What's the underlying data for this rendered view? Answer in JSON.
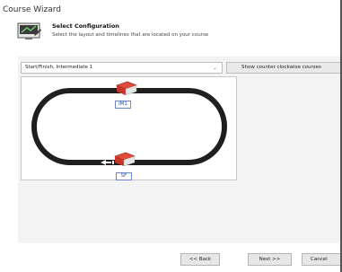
{
  "window": {
    "title": "Course Wizard"
  },
  "header": {
    "title": "Select Configuration",
    "subtitle": "Select the layout and timelines that are located on your course"
  },
  "config": {
    "selected_option": "Start/Finish, Intermediate 1",
    "ccw_button": "Show counter clockwise courses"
  },
  "track": {
    "timeline_top_label": "IM1",
    "timeline_bottom_label": "SF"
  },
  "footer": {
    "back_label": "<< Back",
    "next_label": "Next >>",
    "cancel_label": "Cancel"
  },
  "colors": {
    "panel_bg": "#f3f3f3",
    "track_stroke": "#222222",
    "timeline_book_red": "#d32f2f",
    "label_blue": "#2b4ea2"
  },
  "icons": [
    "wizard-logo-icon",
    "chevron-down-icon",
    "timeline-book-icon",
    "direction-arrow-icon"
  ]
}
